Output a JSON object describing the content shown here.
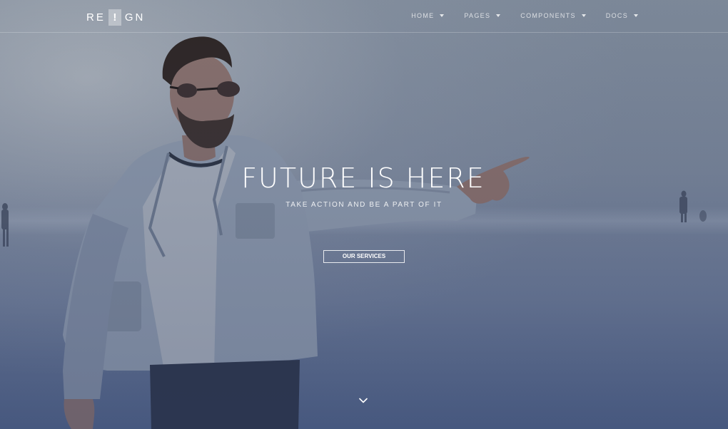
{
  "navbar": {
    "logo_left": "RE",
    "logo_mark": "!",
    "logo_right": "GN",
    "items": [
      {
        "label": "HOME"
      },
      {
        "label": "PAGES"
      },
      {
        "label": "COMPONENTS"
      },
      {
        "label": "DOCS"
      }
    ]
  },
  "hero": {
    "title": "FUTURE IS HERE",
    "subtitle": "TAKE ACTION AND BE A PART OF IT",
    "cta_label": "OUR SERVICES",
    "scroll_icon": "chevron-down-icon"
  },
  "colors": {
    "overlay": "#5b6b8c",
    "text": "#ffffff"
  }
}
